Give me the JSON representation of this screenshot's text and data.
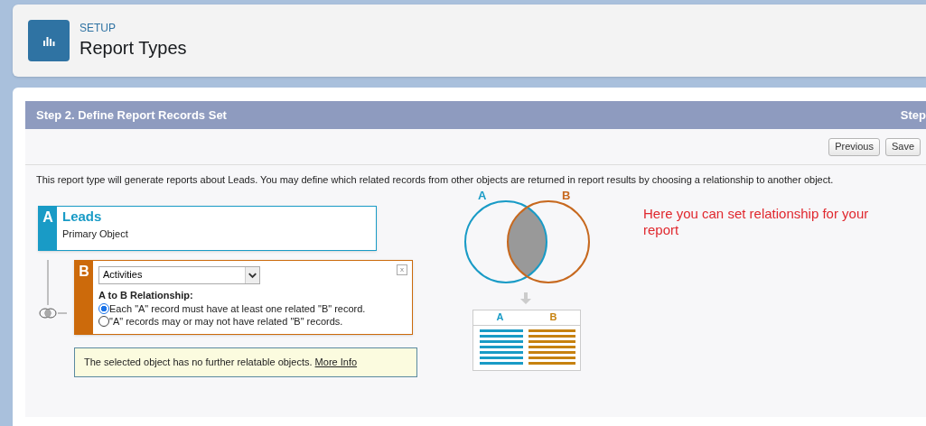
{
  "header": {
    "eyebrow": "SETUP",
    "title": "Report Types"
  },
  "step": {
    "title": "Step 2. Define Report Records Set",
    "right_title": "Step"
  },
  "buttons": [
    {
      "label": "Previous"
    },
    {
      "label": "Save"
    }
  ],
  "intro": "This report type will generate reports about Leads. You may define which related records from other objects are returned in report results by choosing a relationship to another object.",
  "object_a": {
    "letter": "A",
    "name": "Leads",
    "subtitle": "Primary Object"
  },
  "object_b": {
    "letter": "B",
    "select_value": "Activities",
    "close": "x",
    "relationship_label": "A to B Relationship:",
    "options": [
      {
        "label": "Each \"A\" record must have at least one related \"B\" record.",
        "selected": true
      },
      {
        "label": "\"A\" records may or may not have related \"B\" records.",
        "selected": false
      }
    ]
  },
  "notice": {
    "text": "The selected object has no further relatable objects.",
    "link": "More Info"
  },
  "venn": {
    "label_a": "A",
    "label_b": "B",
    "table_a": "A",
    "table_b": "B"
  },
  "annotation": "Here you can set relationship for your report"
}
